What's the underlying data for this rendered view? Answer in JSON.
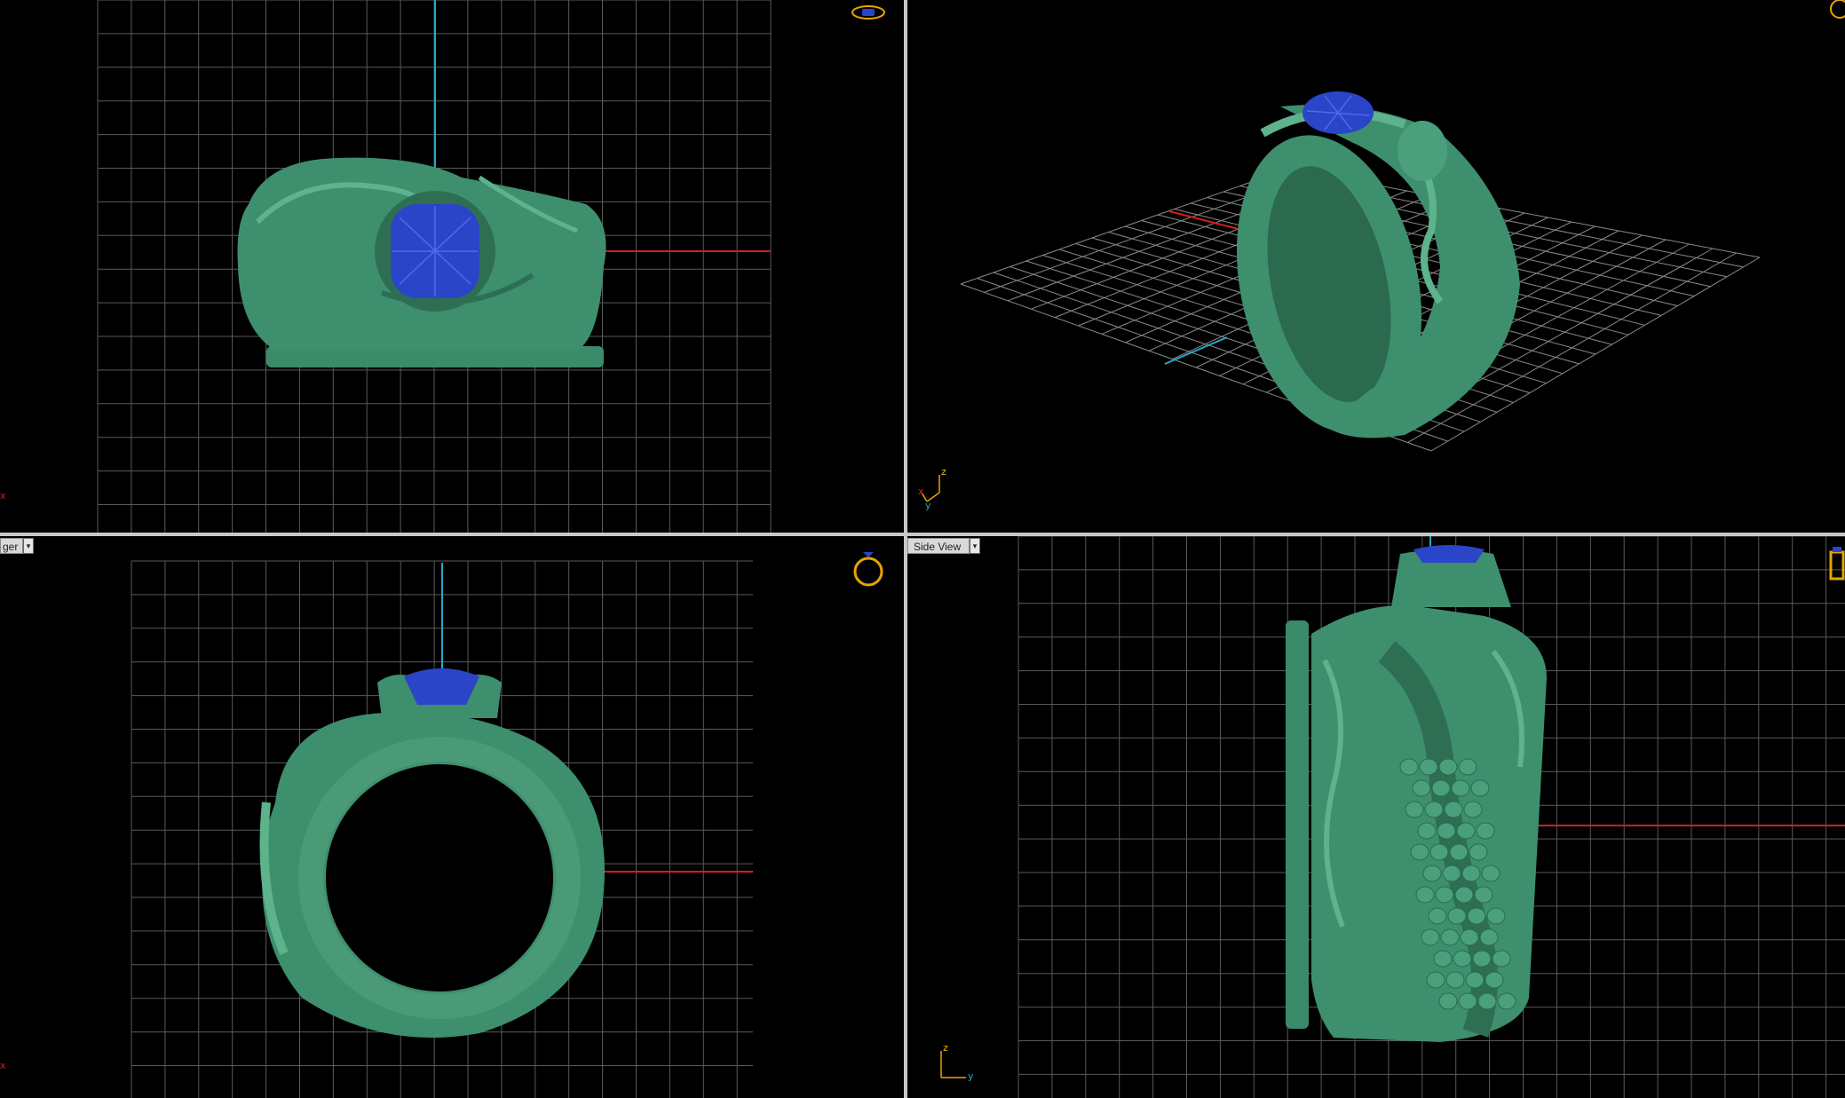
{
  "viewports": {
    "top_left": {
      "label": "",
      "mini_axis": "x"
    },
    "top_right": {
      "label": "",
      "mini_axis_labels": [
        "x",
        "z",
        "y"
      ]
    },
    "bottom_left": {
      "label": "ger",
      "mini_axis": "x"
    },
    "bottom_right": {
      "label": "Side View",
      "mini_axis_labels": [
        "z",
        "y"
      ]
    }
  },
  "colors": {
    "background": "#000000",
    "grid": "#5a5a5a",
    "axis_x": "#d02020",
    "axis_y": "#29a6c8",
    "model": "#3e8f6e",
    "gem": "#2a45c8",
    "nav_icon": "#e8a400"
  },
  "icons": [
    "ring-top-view-icon",
    "ring-perspective-icon",
    "ring-front-icon",
    "ring-side-icon",
    "dropdown-arrow-icon",
    "axis-gizmo-icon"
  ]
}
